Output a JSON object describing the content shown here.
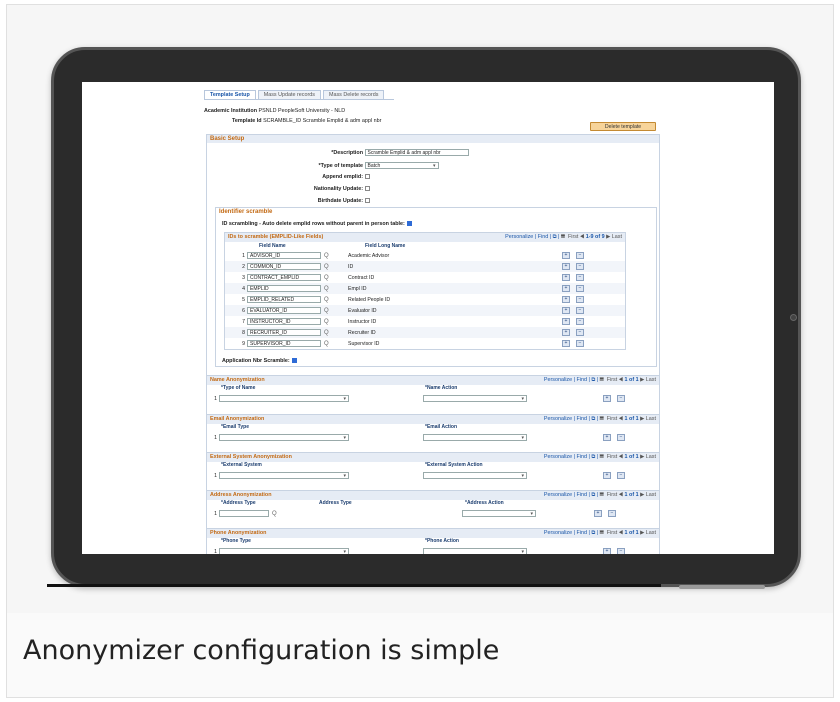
{
  "caption": "Anonymizer configuration is simple",
  "tabs": [
    {
      "label": "Template Setup"
    },
    {
      "label": "Mass Update records"
    },
    {
      "label": "Mass Delete records"
    }
  ],
  "header": {
    "institution_label": "Academic Institution",
    "institution_value": "PSNLD  PeopleSoft University - NLD",
    "template_label": "Template Id",
    "template_value": "SCRAMBLE_ID  Scramble Emplid & adm appl nbr",
    "delete_button": "Delete template"
  },
  "basic": {
    "title": "Basic Setup",
    "description_label": "*Description",
    "description_value": "Scramble Emplid & adm appl nbr",
    "type_label": "*Type of template",
    "type_value": "Batch",
    "append_label": "Append emplid:",
    "nationality_label": "Nationality Update:",
    "birthdate_label": "Birthdate Update:"
  },
  "identifier": {
    "title": "Identifier scramble",
    "auto_delete_label": "ID scrambling - Auto delete emplid rows without parent in person table:",
    "grid_title": "IDs to scramble (EMPLID-Like Fields)",
    "nav": "Personalize | Find | ⧉ |",
    "paging_first": "First",
    "paging_range": "1-9 of 9",
    "paging_last": "Last",
    "col_field_name": "Field Name",
    "col_field_long": "Field Long Name",
    "rows": [
      {
        "n": "1",
        "field": "ADVISOR_ID",
        "long": "Academic Advisor"
      },
      {
        "n": "2",
        "field": "COMMON_ID",
        "long": "ID"
      },
      {
        "n": "3",
        "field": "CONTRACT_EMPLID",
        "long": "Contract ID"
      },
      {
        "n": "4",
        "field": "EMPLID",
        "long": "Empl ID"
      },
      {
        "n": "5",
        "field": "EMPLID_RELATED",
        "long": "Related People ID"
      },
      {
        "n": "6",
        "field": "EVALUATOR_ID",
        "long": "Evaluator ID"
      },
      {
        "n": "7",
        "field": "INSTRUCTOR_ID",
        "long": "Instructor ID"
      },
      {
        "n": "8",
        "field": "RECRUITER_ID",
        "long": "Recruiter ID"
      },
      {
        "n": "9",
        "field": "SUPERVISOR_ID",
        "long": "Supervisor ID"
      }
    ],
    "app_nbr_label": "Application Nbr Scramble:"
  },
  "anon": [
    {
      "title": "Name Anonymization",
      "col1": "*Type of Name",
      "col2": "*Name Action",
      "col_mid": ""
    },
    {
      "title": "Email Anonymization",
      "col1": "*Email Type",
      "col2": "*Email Action",
      "col_mid": ""
    },
    {
      "title": "External System Anonymization",
      "col1": "*External System",
      "col2": "*External System Action",
      "col_mid": ""
    },
    {
      "title": "Address Anonymization",
      "col1": "*Address Type",
      "col2": "*Address Action",
      "col_mid": "Address Type"
    },
    {
      "title": "Phone Anonymization",
      "col1": "*Phone Type",
      "col2": "*Phone Action",
      "col_mid": ""
    }
  ],
  "anon_nav": "Personalize | Find | ⧉ |",
  "anon_paging": "1 of 1",
  "anon_first": "First",
  "anon_last": "Last",
  "row_num": "1",
  "plus": "+",
  "minus": "−",
  "lookup_glyph": "Q"
}
